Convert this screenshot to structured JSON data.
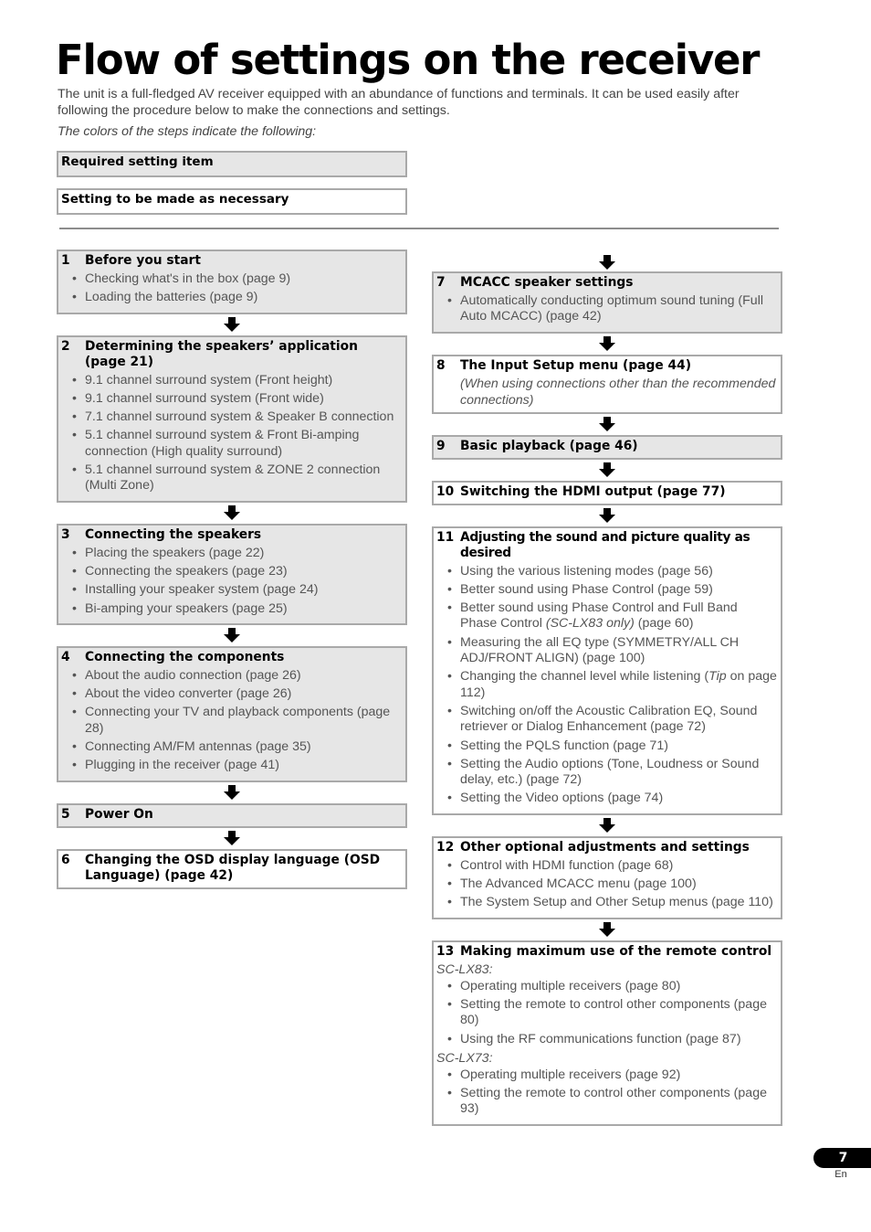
{
  "page": {
    "title": "Flow of settings on the receiver",
    "intro": "The unit is a full-fledged AV receiver equipped with an abundance of functions and terminals. It can be used easily after following the procedure below to make the connections and settings.",
    "colors_note": "The colors of the steps indicate the following:",
    "legend": {
      "required": "Required setting item",
      "optional": "Setting to be made as necessary"
    },
    "colors": {
      "required_bg": "#e6e6e6",
      "optional_bg": "#ffffff",
      "border": "#a9a9a9"
    },
    "page_number": "7",
    "language": "En"
  },
  "steps": {
    "s1": {
      "num": "1",
      "title": "Before you start",
      "type": "required",
      "items": [
        "Checking what's in the box (page 9)",
        "Loading the batteries (page 9)"
      ]
    },
    "s2": {
      "num": "2",
      "title": "Determining the speakers’ application (page 21)",
      "type": "required",
      "items": [
        "9.1 channel surround system (Front height)",
        "9.1 channel surround system (Front wide)",
        "7.1 channel surround system & Speaker B connection",
        "5.1 channel surround system & Front Bi-amping connection (High quality surround)",
        "5.1 channel surround system & ZONE 2 connection (Multi Zone)"
      ]
    },
    "s3": {
      "num": "3",
      "title": "Connecting the speakers",
      "type": "required",
      "items": [
        "Placing the speakers (page 22)",
        "Connecting the speakers (page 23)",
        "Installing your speaker system (page 24)",
        "Bi-amping your speakers (page 25)"
      ]
    },
    "s4": {
      "num": "4",
      "title": "Connecting the components",
      "type": "required",
      "items": [
        "About the audio connection (page 26)",
        "About the video converter (page 26)",
        "Connecting your TV and playback components (page 28)",
        "Connecting AM/FM antennas (page 35)",
        "Plugging in the receiver (page 41)"
      ]
    },
    "s5": {
      "num": "5",
      "title": "Power On",
      "type": "required"
    },
    "s6": {
      "num": "6",
      "title": "Changing the OSD display language (OSD Language) (page 42)",
      "type": "optional"
    },
    "s7": {
      "num": "7",
      "title": "MCACC speaker settings",
      "type": "required",
      "items": [
        "Automatically conducting optimum sound tuning (Full Auto MCACC) (page 42)"
      ]
    },
    "s8": {
      "num": "8",
      "title": "The Input Setup menu (page 44)",
      "type": "optional",
      "note": "(When using connections other than the recommended connections)"
    },
    "s9": {
      "num": "9",
      "title": "Basic playback (page 46)",
      "type": "required"
    },
    "s10": {
      "num": "10",
      "title": "Switching the HDMI output (page 77)",
      "type": "optional"
    },
    "s11": {
      "num": "11",
      "title": "Adjusting the sound and picture quality as desired",
      "type": "optional",
      "items": {
        "i1": "Using the various listening modes (page 56)",
        "i2": "Better sound using Phase Control (page 59)",
        "i3a": "Better sound using Phase Control and Full Band Phase Control ",
        "i3b": "(SC-LX83 only)",
        "i3c": " (page 60)",
        "i4": "Measuring the all EQ type (SYMMETRY/ALL CH ADJ/FRONT ALIGN) (page 100)",
        "i5a": "Changing the channel level while listening (",
        "i5b": "Tip",
        "i5c": " on page 112)",
        "i6": "Switching on/off the Acoustic Calibration EQ, Sound retriever or Dialog Enhancement (page 72)",
        "i7": "Setting the PQLS function (page 71)",
        "i8": "Setting the Audio options (Tone, Loudness or Sound delay, etc.) (page 72)",
        "i9": "Setting the Video options (page 74)"
      }
    },
    "s12": {
      "num": "12",
      "title": "Other optional adjustments and settings",
      "type": "optional",
      "items": [
        "Control with HDMI function (page 68)",
        "The Advanced MCACC menu (page 100)",
        "The System Setup and Other Setup menus (page 110)"
      ]
    },
    "s13": {
      "num": "13",
      "title": "Making maximum use of the remote control",
      "type": "optional",
      "groups": [
        {
          "model": "SC-LX83:",
          "items": [
            "Operating multiple receivers (page 80)",
            "Setting the remote to control other components (page 80)",
            "Using the RF communications function (page 87)"
          ]
        },
        {
          "model": "SC-LX73:",
          "items": [
            "Operating multiple receivers (page 92)",
            "Setting the remote to control other components (page 93)"
          ]
        }
      ]
    }
  },
  "icons": {
    "flow_arrow": "down-arrow-icon"
  }
}
